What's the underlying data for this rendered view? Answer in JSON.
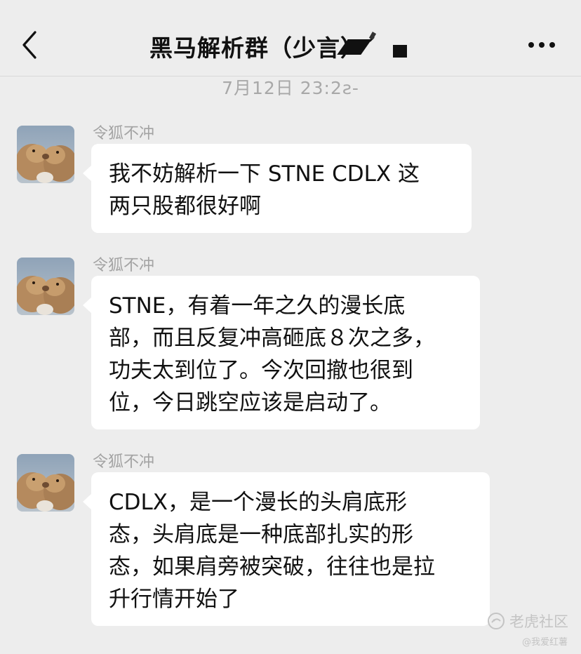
{
  "header": {
    "title": "黑马解析群（少言）´",
    "back_icon": "chevron-left-icon",
    "more_icon": "more-dots-icon"
  },
  "timestamp": "7月12日 23:2ƨ-",
  "messages": [
    {
      "sender": "令狐不冲",
      "avatar": "prairie-dogs-avatar",
      "text": "我不妨解析一下 STNE  CDLX  这\n两只股都很好啊"
    },
    {
      "sender": "令狐不冲",
      "avatar": "prairie-dogs-avatar",
      "text": "STNE，有着一年之久的漫长底\n部，而且反复冲高砸底８次之多，\n功夫太到位了。今次回撤也很到\n位，今日跳空应该是启动了。"
    },
    {
      "sender": "令狐不冲",
      "avatar": "prairie-dogs-avatar",
      "text": "CDLX，是一个漫长的头肩底形\n态，头肩底是一种底部扎实的形\n态，如果肩旁被突破，往往也是拉\n升行情开始了"
    }
  ],
  "watermark": {
    "main": "老虎社区",
    "sub": "@我爱红薯",
    "icon": "tiger-community-logo-icon"
  },
  "colors": {
    "background": "#ededed",
    "bubble": "#ffffff",
    "sender": "#a3a3a3",
    "timestamp": "#a8a8a8"
  }
}
